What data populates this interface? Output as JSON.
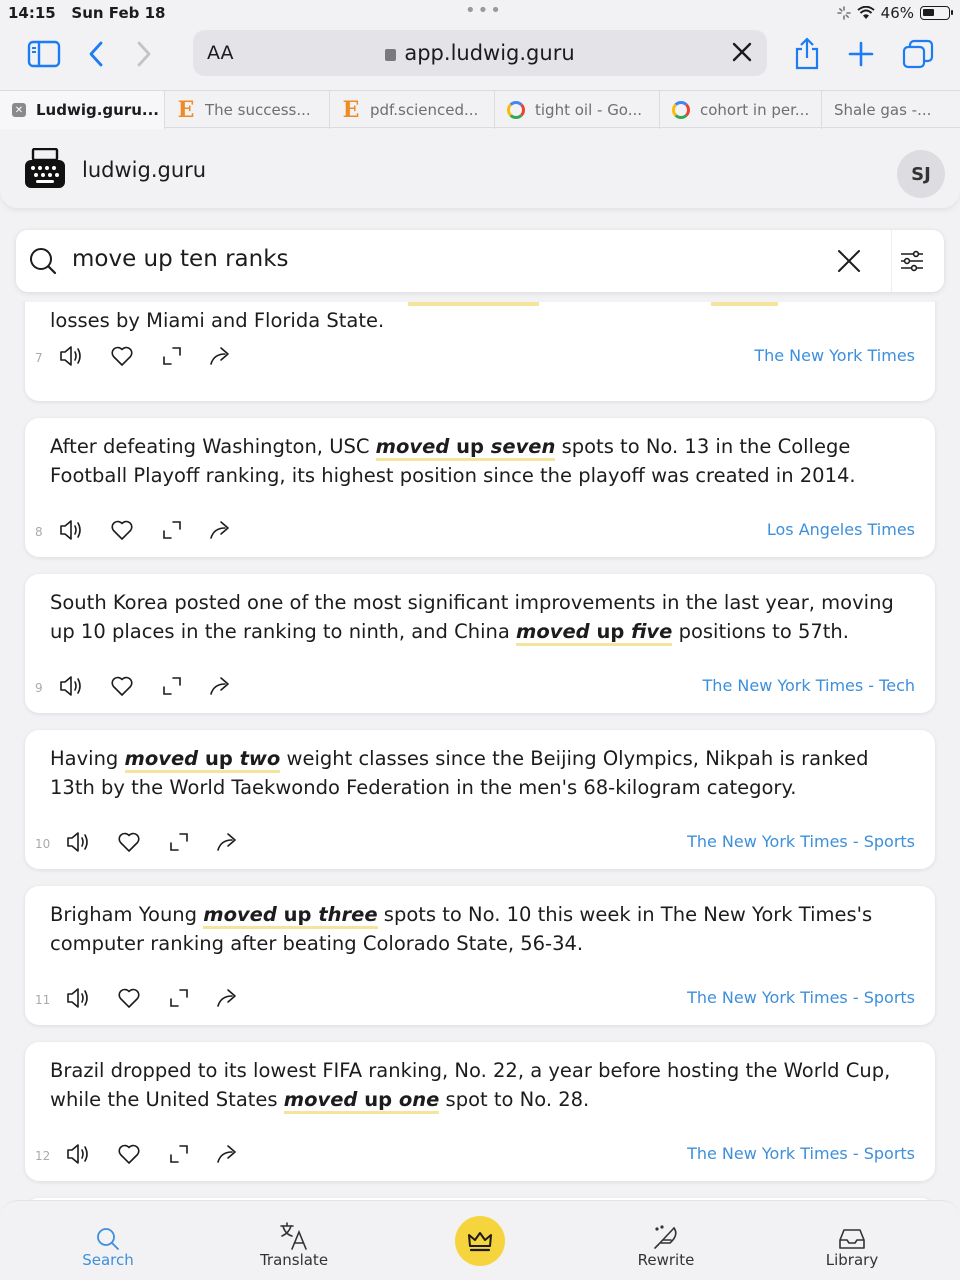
{
  "status_bar": {
    "time": "14:15",
    "date": "Sun Feb 18",
    "battery": "46%",
    "battery_level": 0.46
  },
  "browser": {
    "reader_label": "AA",
    "url": "app.ludwig.guru",
    "tabs": [
      {
        "title": "Ludwig.guru...",
        "favicon": "close-favicon"
      },
      {
        "title": "The success...",
        "favicon": "elsevier-favicon"
      },
      {
        "title": "pdf.scienced...",
        "favicon": "elsevier-favicon"
      },
      {
        "title": "tight oil - Go...",
        "favicon": "google-favicon"
      },
      {
        "title": "cohort in per...",
        "favicon": "google-favicon"
      },
      {
        "title": "Shale gas -...",
        "favicon": "none"
      }
    ]
  },
  "app": {
    "brand": "ludwig.guru",
    "avatar_initials": "SJ"
  },
  "search": {
    "query": "move up ten ranks"
  },
  "results": [
    {
      "num": "7",
      "pre": "losses by Miami and Florida State.",
      "hl1": "",
      "hl2": "",
      "hl3": "",
      "post": "",
      "source": "The New York Times"
    },
    {
      "num": "8",
      "pre": "After defeating Washington, USC ",
      "hl1": "moved",
      "hl2": "up",
      "hl3": "seven",
      "post": " spots to No. 13 in the College Football Playoff ranking, its highest position since the playoff was created in 2014.",
      "source": "Los Angeles Times"
    },
    {
      "num": "9",
      "pre": "South Korea posted one of the most significant improvements in the last year, moving up 10 places in the ranking to ninth, and China ",
      "hl1": "moved",
      "hl2": "up",
      "hl3": "five",
      "post": " positions to 57th.",
      "source": "The New York Times - Tech"
    },
    {
      "num": "10",
      "pre": "Having ",
      "hl1": "moved",
      "hl2": "up",
      "hl3": "two",
      "post": " weight classes since the Beijing Olympics, Nikpah is ranked 13th by the World Taekwondo Federation in the men's 68-kilogram category.",
      "source": "The New York Times - Sports"
    },
    {
      "num": "11",
      "pre": "Brigham Young ",
      "hl1": "moved",
      "hl2": "up",
      "hl3": "three",
      "post": " spots to No. 10 this week in The New York Times's computer ranking after beating Colorado State, 56-34.",
      "source": "The New York Times - Sports"
    },
    {
      "num": "12",
      "pre": "Brazil dropped to its lowest FIFA ranking, No. 22, a year before hosting the World Cup, while the United States ",
      "hl1": "moved",
      "hl2": "up",
      "hl3": "one",
      "post": " spot to No. 28.",
      "source": "The New York Times - Sports"
    }
  ],
  "bottom_nav": {
    "search": "Search",
    "translate": "Translate",
    "rewrite": "Rewrite",
    "library": "Library"
  },
  "colors": {
    "accent": "#3d8fdc",
    "highlight": "#f5e49c",
    "crown": "#f5d43d",
    "safari_blue": "#1c7cf4"
  }
}
